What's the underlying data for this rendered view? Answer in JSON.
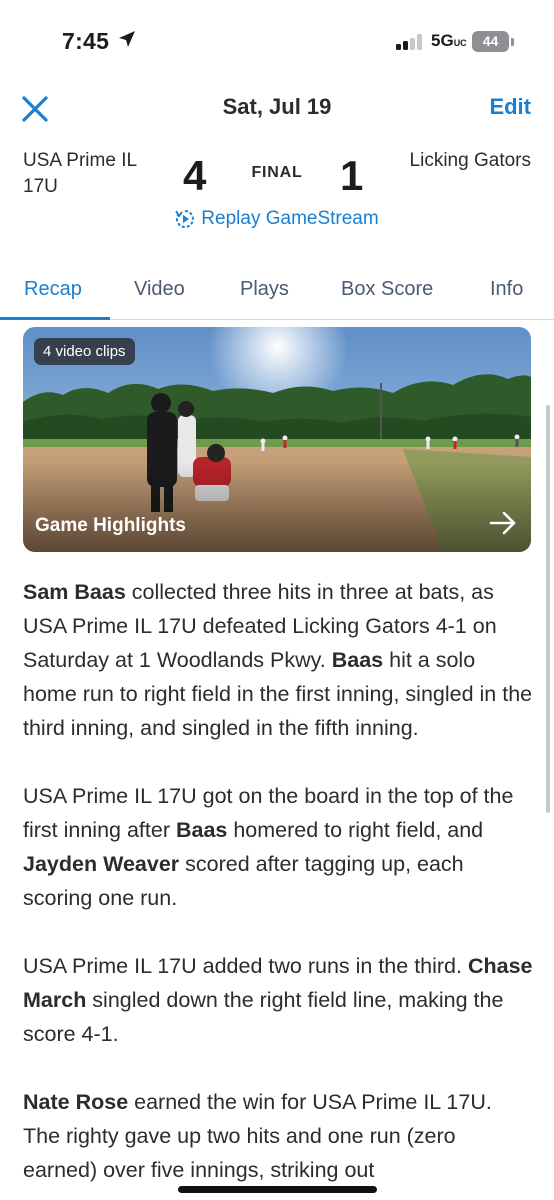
{
  "status": {
    "time": "7:45",
    "network": "5G",
    "network_suffix": "UC",
    "battery": "44"
  },
  "nav": {
    "date": "Sat, Jul 19",
    "edit_label": "Edit"
  },
  "game": {
    "home_team": "USA Prime IL 17U",
    "away_team": "Licking Gators",
    "home_score": "4",
    "away_score": "1",
    "status": "FINAL",
    "replay_label": "Replay GameStream"
  },
  "tabs": [
    {
      "label": "Recap",
      "active": true
    },
    {
      "label": "Video",
      "active": false
    },
    {
      "label": "Plays",
      "active": false
    },
    {
      "label": "Box Score",
      "active": false
    },
    {
      "label": "Info",
      "active": false
    }
  ],
  "highlights": {
    "clips_badge": "4 video clips",
    "title": "Game Highlights"
  },
  "recap": {
    "p1": [
      {
        "t": "Sam Baas",
        "b": true
      },
      {
        "t": " collected three hits in three at bats, as USA Prime IL 17U defeated Licking Gators 4-1 on Saturday at 1 Woodlands Pkwy. ",
        "b": false
      },
      {
        "t": "Baas",
        "b": true
      },
      {
        "t": " hit a solo home run to right field in the first inning, singled in the third inning, and singled in the fifth inning.",
        "b": false
      }
    ],
    "p2": [
      {
        "t": "USA Prime IL 17U got on the board in the top of the first inning after ",
        "b": false
      },
      {
        "t": "Baas",
        "b": true
      },
      {
        "t": " homered to right field, and ",
        "b": false
      },
      {
        "t": "Jayden Weaver",
        "b": true
      },
      {
        "t": " scored after tagging up, each scoring one run.",
        "b": false
      }
    ],
    "p3": [
      {
        "t": "USA Prime IL 17U added two runs in the third. ",
        "b": false
      },
      {
        "t": "Chase March",
        "b": true
      },
      {
        "t": " singled down the right field line, making the score 4-1.",
        "b": false
      }
    ],
    "p4": [
      {
        "t": "Nate Rose",
        "b": true
      },
      {
        "t": " earned the win for USA Prime IL 17U. The righty gave up two hits and one run (zero earned) over five innings, striking out",
        "b": false
      }
    ]
  },
  "colors": {
    "accent": "#1a7fd1",
    "text": "#2c2c2e",
    "tab_inactive": "#4a5a70"
  },
  "icons": {
    "close": "close-icon",
    "replay": "replay-icon",
    "arrow": "arrow-right-icon",
    "location": "location-arrow-icon"
  }
}
